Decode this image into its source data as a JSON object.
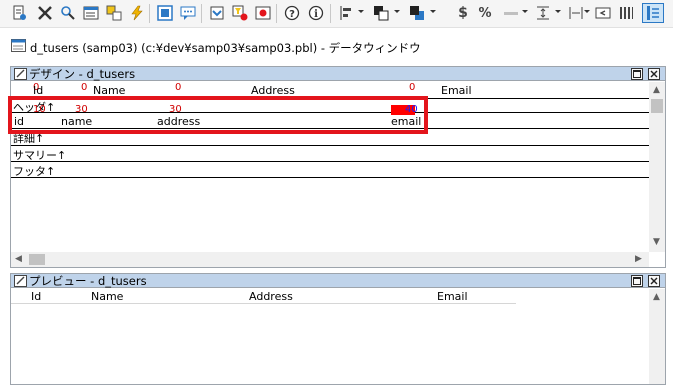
{
  "window": {
    "title": "d_tusers  (samp03) (c:¥dev¥samp03¥samp03.pbl) - データウィンドウ"
  },
  "toolbar": {
    "icons": [
      "properties-icon",
      "tools-icon",
      "search-icon",
      "datawindow-icon",
      "layers-icon",
      "lightning-icon",
      "grid-select-icon",
      "comment-icon",
      "import-icon",
      "filter-icon",
      "record-icon",
      "help-icon",
      "info-icon",
      "align-icon",
      "bring-front-icon",
      "send-back-icon",
      "currency-icon",
      "percent-icon",
      "line-icon",
      "spacing-icon",
      "tab-order-icon",
      "columns-icon",
      "active-column-icon"
    ],
    "currency_glyph": "$",
    "percent_glyph": "%"
  },
  "design": {
    "title": "デザイン - d_tusers",
    "header_labels": [
      "Id",
      "Name",
      "Address",
      "Email"
    ],
    "header_tab_numbers": [
      "0",
      "0",
      "0",
      "0"
    ],
    "detail_tab_numbers": [
      "10",
      "30",
      "30",
      "40"
    ],
    "detail_columns": [
      "id",
      "name",
      "address",
      "email"
    ],
    "bands": {
      "header": "ヘッダ↑",
      "detail": "詳細↑",
      "summary": "サマリー↑",
      "footer": "フッタ↑"
    }
  },
  "preview": {
    "title": "プレビュー - d_tusers",
    "columns": [
      "Id",
      "Name",
      "Address",
      "Email"
    ]
  },
  "colors": {
    "panel_bar": "#bfd3ea",
    "highlight_box": "#e3151c",
    "tab_number": "#d00000",
    "selected_field": "#ff0000"
  }
}
